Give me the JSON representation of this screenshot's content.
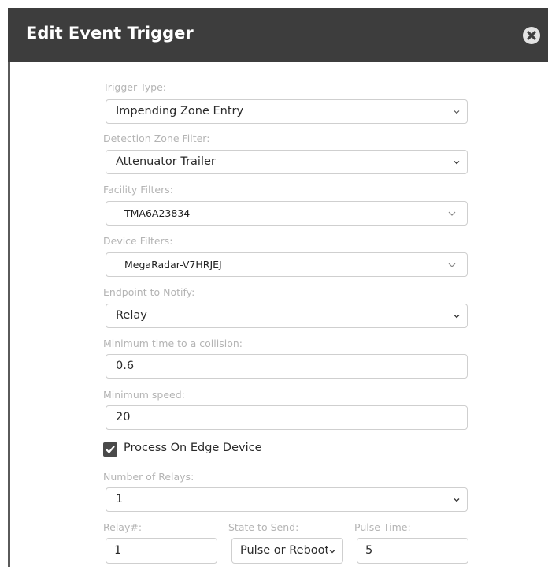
{
  "dialog": {
    "title": "Edit Event Trigger",
    "close_icon": "close-circle-icon"
  },
  "trigger_type": {
    "label": "Trigger Type:",
    "value": "Impending Zone Entry"
  },
  "detection_zone": {
    "label": "Detection Zone Filter:",
    "value": "Attenuator Trailer"
  },
  "facility_filters": {
    "label": "Facility Filters:",
    "value": "TMA6A23834"
  },
  "device_filters": {
    "label": "Device Filters:",
    "value": "MegaRadar-V7HRJEJ"
  },
  "endpoint": {
    "label": "Endpoint to Notify:",
    "value": "Relay"
  },
  "min_collision_time": {
    "label": "Minimum time to a collision:",
    "value": "0.6"
  },
  "min_speed": {
    "label": "Minimum speed:",
    "value": "20"
  },
  "process_on_edge": {
    "label": "Process On Edge Device",
    "checked": true
  },
  "num_relays": {
    "label": "Number of Relays:",
    "value": "1"
  },
  "relay_table": {
    "col_relay": "Relay#:",
    "col_state": "State to Send:",
    "col_pulse": "Pulse Time:",
    "relay_value": "1",
    "state_value": "Pulse or Reboot",
    "pulse_value": "5"
  },
  "colors": {
    "header_bg": "#3d3d3d",
    "label_gray": "#b4b4b4",
    "border_gray": "#cfcfcf"
  }
}
